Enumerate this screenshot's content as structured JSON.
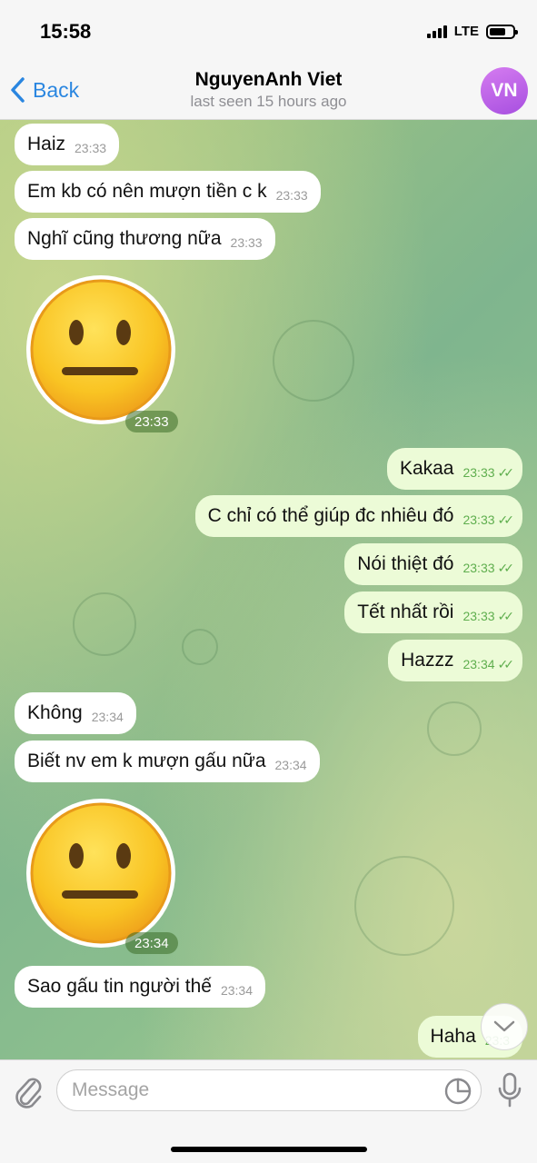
{
  "status_bar": {
    "time": "15:58",
    "network": "LTE"
  },
  "header": {
    "back_label": "Back",
    "contact_name": "NguyenAnh Viet",
    "last_seen": "last seen 15 hours ago",
    "avatar_initials": "VN"
  },
  "messages": [
    {
      "dir": "in",
      "text": "Haiz",
      "time": "23:33"
    },
    {
      "dir": "in",
      "text": "Em kb có nên mượn tiền c k",
      "time": "23:33"
    },
    {
      "dir": "in",
      "text": "Nghĩ cũng thương nữa",
      "time": "23:33"
    },
    {
      "dir": "in",
      "type": "sticker",
      "emoji": "neutral-face",
      "time": "23:33"
    },
    {
      "dir": "out",
      "text": "Kakaa",
      "time": "23:33",
      "read": true
    },
    {
      "dir": "out",
      "text": "C chỉ có thể giúp đc nhiêu đó",
      "time": "23:33",
      "read": true
    },
    {
      "dir": "out",
      "text": "Nói thiệt đó",
      "time": "23:33",
      "read": true
    },
    {
      "dir": "out",
      "text": "Tết nhất rồi",
      "time": "23:33",
      "read": true
    },
    {
      "dir": "out",
      "text": "Hazzz",
      "time": "23:34",
      "read": true
    },
    {
      "dir": "in",
      "text": "Không",
      "time": "23:34"
    },
    {
      "dir": "in",
      "text": "Biết nv em k mượn gấu nữa",
      "time": "23:34"
    },
    {
      "dir": "in",
      "type": "sticker",
      "emoji": "neutral-face",
      "time": "23:34"
    },
    {
      "dir": "in",
      "text": "Sao gấu tin người thế",
      "time": "23:34"
    },
    {
      "dir": "out",
      "text": "Haha",
      "time": "23:3"
    }
  ],
  "input": {
    "placeholder": "Message"
  },
  "colors": {
    "accent": "#2a86e0",
    "outgoing_bubble": "#ecfbd7",
    "incoming_bubble": "#ffffff",
    "read_check": "#5fae4e",
    "avatar": "#c066ea"
  },
  "icons": [
    "signal-icon",
    "battery-icon",
    "back-chevron-icon",
    "paperclip-icon",
    "sticker-icon",
    "microphone-icon",
    "chevron-down-icon",
    "double-check-icon"
  ]
}
